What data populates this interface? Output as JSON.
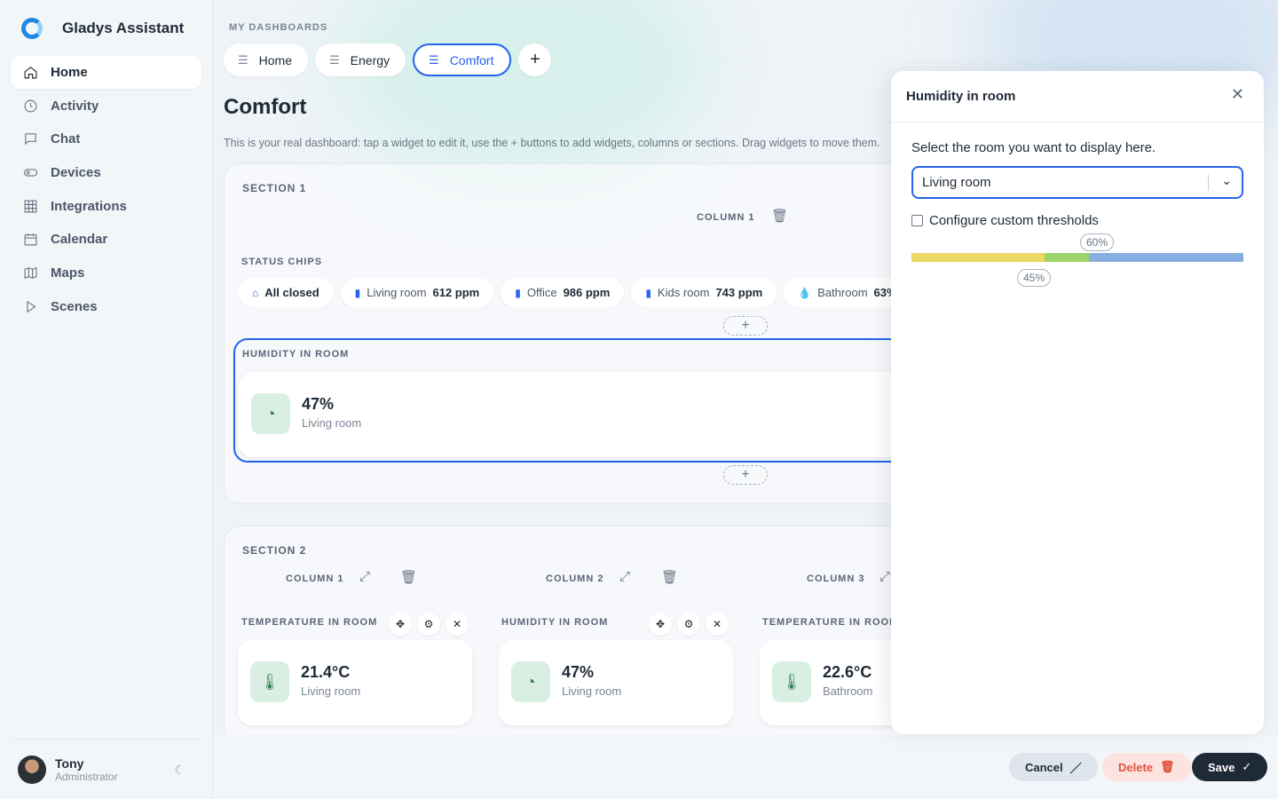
{
  "app": {
    "name": "Gladys Assistant"
  },
  "nav": [
    {
      "label": "Home",
      "icon": "home-icon",
      "active": true
    },
    {
      "label": "Activity",
      "icon": "clock-icon"
    },
    {
      "label": "Chat",
      "icon": "chat-icon"
    },
    {
      "label": "Devices",
      "icon": "toggle-icon"
    },
    {
      "label": "Integrations",
      "icon": "grid-icon"
    },
    {
      "label": "Calendar",
      "icon": "calendar-icon"
    },
    {
      "label": "Maps",
      "icon": "map-icon"
    },
    {
      "label": "Scenes",
      "icon": "play-icon"
    }
  ],
  "user": {
    "name": "Tony",
    "role": "Administrator"
  },
  "dashboards": {
    "label": "MY DASHBOARDS",
    "tabs": [
      {
        "label": "Home"
      },
      {
        "label": "Energy"
      },
      {
        "label": "Comfort",
        "active": true
      }
    ],
    "add_label": "+"
  },
  "page": {
    "title": "Comfort",
    "description": "This is your real dashboard: tap a widget to edit it, use the + buttons to add widgets, columns or sections. Drag widgets to move them."
  },
  "section1": {
    "title": "SECTION 1",
    "column": "COLUMN 1",
    "status_chips": {
      "title": "STATUS CHIPS",
      "chips": [
        {
          "label": "",
          "value": "All closed",
          "icon": "home-icon"
        },
        {
          "label": "Living room",
          "value": "612 ppm",
          "icon": "bar-chart-icon"
        },
        {
          "label": "Office",
          "value": "986 ppm",
          "icon": "bar-chart-icon"
        },
        {
          "label": "Kids room",
          "value": "743 ppm",
          "icon": "bar-chart-icon"
        },
        {
          "label": "Bathroom",
          "value": "63%",
          "icon": "drop-icon"
        }
      ]
    },
    "humidity_widget": {
      "title": "HUMIDITY IN ROOM",
      "value": "47%",
      "room": "Living room"
    }
  },
  "section2": {
    "title": "SECTION 2",
    "columns": [
      {
        "title": "COLUMN 1",
        "widget_title": "TEMPERATURE IN ROOM",
        "value": "21.4°C",
        "room": "Living room",
        "icon": "thermometer-icon"
      },
      {
        "title": "COLUMN 2",
        "widget_title": "HUMIDITY IN ROOM",
        "value": "47%",
        "room": "Living room",
        "icon": "drop-icon"
      },
      {
        "title": "COLUMN 3",
        "widget_title": "TEMPERATURE IN ROOM",
        "value": "22.6°C",
        "room": "Bathroom",
        "icon": "thermometer-icon"
      }
    ]
  },
  "actions": {
    "cancel": "Cancel",
    "delete": "Delete",
    "save": "Save"
  },
  "panel": {
    "title": "Humidity in room",
    "prompt": "Select the room you want to display here.",
    "selected_room": "Living room",
    "custom_thresholds_label": "Configure custom thresholds",
    "custom_thresholds_checked": false,
    "threshold_high": "60%",
    "threshold_low": "45%",
    "colors": {
      "low": "#ebd766",
      "mid": "#9ed36a",
      "high": "#86aee0"
    }
  },
  "colors": {
    "accent": "#2563eb",
    "danger": "#e0533f",
    "dark": "#1f2a37"
  }
}
